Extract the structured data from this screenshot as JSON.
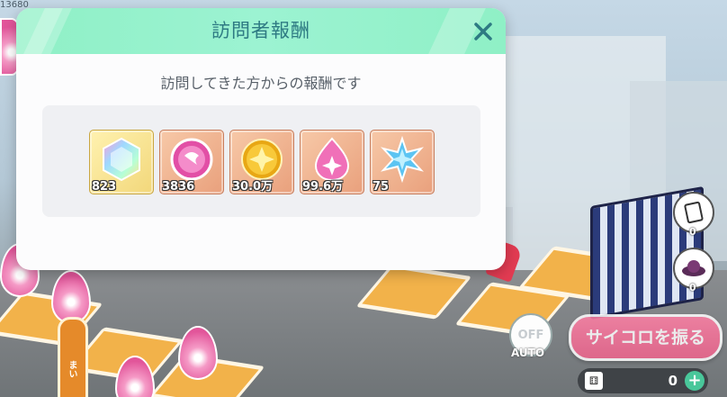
{
  "hud": {
    "top_left_number": "13680",
    "side_counts": [
      "0",
      "0"
    ],
    "auto_button": {
      "state": "OFF",
      "label": "AUTO"
    },
    "roll_dice_button": "サイコロを振る",
    "dice_count": "0",
    "sign_text": "まい",
    "dice_count_icon": "dice-icon",
    "add_icon": "plus-icon"
  },
  "dialog": {
    "title": "訪問者報酬",
    "subtitle": "訪問してきた方からの報酬です",
    "close_icon": "close-icon",
    "rewards": [
      {
        "icon": "rainbow-crystal-icon",
        "quantity": "823",
        "frame": "gold"
      },
      {
        "icon": "pink-orb-icon",
        "quantity": "3836",
        "frame": "bronze"
      },
      {
        "icon": "gold-coin-icon",
        "quantity": "30.0万",
        "frame": "bronze"
      },
      {
        "icon": "pink-gem-icon",
        "quantity": "99.6万",
        "frame": "bronze"
      },
      {
        "icon": "blue-star-icon",
        "quantity": "75",
        "frame": "bronze"
      }
    ]
  },
  "colors": {
    "header_mint": "#9cf3d2",
    "title_teal": "#2e7a83",
    "dice_button_pink": "#f0648d",
    "item_frame_bronze": "#e9a07c",
    "item_frame_gold": "#f2d77a"
  }
}
